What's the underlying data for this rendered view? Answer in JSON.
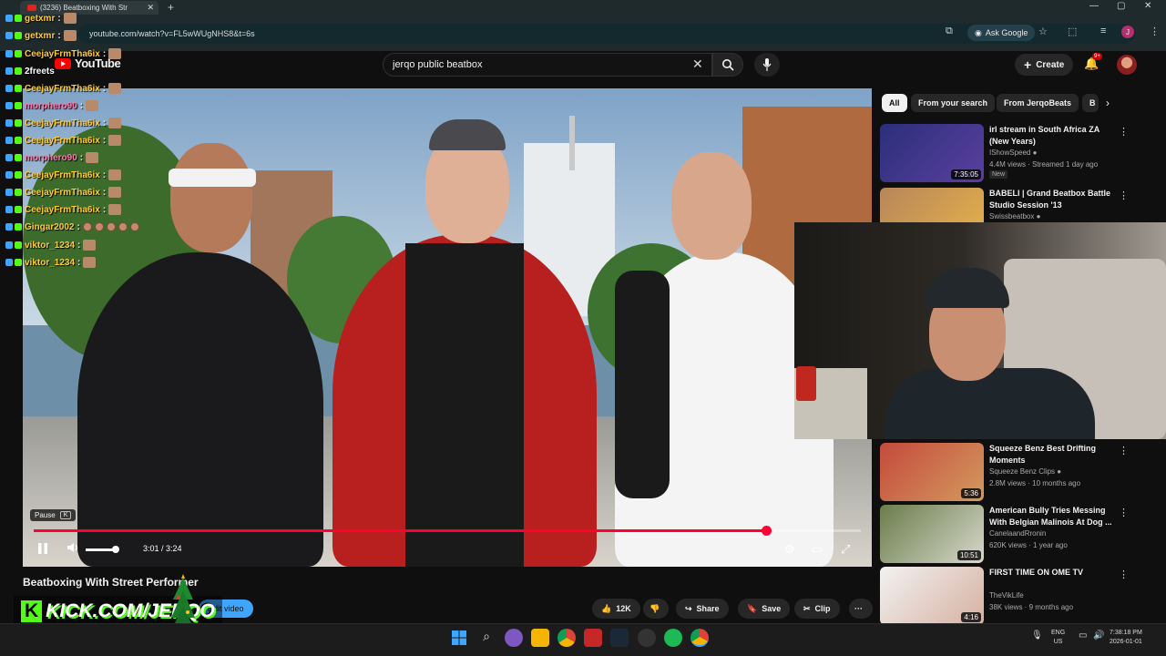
{
  "browser": {
    "tab_title": "(3236) Beatboxing With Str",
    "url": "youtube.com/watch?v=FL5wWUgNHS8&t=6s",
    "ask_google": "Ask Google",
    "new_tab": "+",
    "avatar_letter": "J"
  },
  "youtube": {
    "logo_text": "YouTube",
    "search_query": "jerqo public beatbox",
    "create_label": "Create",
    "notification_count": "9+"
  },
  "player": {
    "tooltip_label": "Pause",
    "tooltip_key": "K",
    "time": "3:01 / 3:24",
    "progress_fraction": 0.886
  },
  "video": {
    "title": "Beatboxing With Street Performer",
    "edit_label": "Edit video",
    "likes": "12K",
    "share_label": "Share",
    "save_label": "Save",
    "clip_label": "Clip",
    "more": "···"
  },
  "overlay": {
    "kick_text": "KICK.COM/JERQO",
    "kick_badge": "K"
  },
  "sidebar": {
    "chips": [
      "All",
      "From your search",
      "From JerqoBeats",
      "B"
    ],
    "recommendations": [
      {
        "title": "irl stream in South Africa ZA (New Years)",
        "channel": "IShowSpeed ●",
        "meta": "4.4M views · Streamed 1 day ago",
        "badge": "New",
        "duration": "7:35:05",
        "colors": [
          "#2b2f7a",
          "#5b3fa0"
        ]
      },
      {
        "title": "BABELI | Grand Beatbox Battle Studio Session '13",
        "channel": "Swissbeatbox ●",
        "meta": "",
        "badge": "",
        "duration": "",
        "colors": [
          "#b7865a",
          "#e6b24a"
        ]
      },
      {
        "title": "Squeeze Benz Best Drifting Moments",
        "channel": "Squeeze Benz Clips ●",
        "meta": "2.8M views · 10 months ago",
        "badge": "",
        "duration": "5:36",
        "colors": [
          "#c44a3c",
          "#d49a5e"
        ]
      },
      {
        "title": "American Bully Tries Messing With Belgian Malinois At Dog ...",
        "channel": "CanelaandRronin",
        "meta": "620K views · 1 year ago",
        "badge": "",
        "duration": "10:51",
        "colors": [
          "#6a7d4a",
          "#d8d8cc"
        ]
      },
      {
        "title": "FIRST TIME ON OME TV",
        "channel": "TheVikLife",
        "meta": "38K views · 9 months ago",
        "badge": "",
        "duration": "4:16",
        "colors": [
          "#f2f2f2",
          "#d6b0a0"
        ]
      }
    ]
  },
  "chat": [
    {
      "user": "getxmr",
      "text": ":",
      "color": "#ffcc33",
      "emotes": 1
    },
    {
      "user": "getxmr",
      "text": ":",
      "color": "#ffcc33",
      "emotes": 1
    },
    {
      "user": "CeejayFrmTha6ix",
      "text": ":",
      "color": "#ffcc33",
      "emotes": 1
    },
    {
      "user": "2freets",
      "text": "",
      "color": "#ffffff",
      "emotes": 0
    },
    {
      "user": "CeejayFrmTha6ix",
      "text": ":",
      "color": "#ffcc33",
      "emotes": 1
    },
    {
      "user": "morphero90",
      "text": ":",
      "color": "#ff77aa",
      "emotes": 1
    },
    {
      "user": "CeejayFrmTha6ix",
      "text": ":",
      "color": "#ffcc33",
      "emotes": 1
    },
    {
      "user": "CeejayFrmTha6ix",
      "text": ":",
      "color": "#ffcc33",
      "emotes": 1
    },
    {
      "user": "morphero90",
      "text": ":",
      "color": "#ff77aa",
      "emotes": 1
    },
    {
      "user": "CeejayFrmTha6ix",
      "text": ":",
      "color": "#ffcc33",
      "emotes": 1
    },
    {
      "user": "CeejayFrmTha6ix",
      "text": ":",
      "color": "#ffcc33",
      "emotes": 1
    },
    {
      "user": "CeejayFrmTha6ix",
      "text": ":",
      "color": "#ffcc33",
      "emotes": 1
    },
    {
      "user": "Gingar2002",
      "text": ":",
      "color": "#ffcc33",
      "emotes": 5
    },
    {
      "user": "viktor_1234",
      "text": ":",
      "color": "#ffcc33",
      "emotes": 1
    },
    {
      "user": "viktor_1234",
      "text": ":",
      "color": "#ffcc33",
      "emotes": 1
    }
  ],
  "taskbar": {
    "lang_top": "ENG",
    "lang_bottom": "US",
    "clock_time": "7:38:18 PM",
    "clock_date": "2026-01-01"
  },
  "colors": {
    "accent": "#ff0033",
    "kick_green": "#53fc18",
    "chat_gold": "#ffcc33"
  }
}
